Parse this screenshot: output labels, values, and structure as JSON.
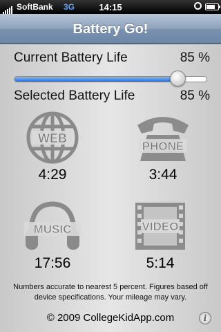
{
  "status_bar": {
    "carrier": "SoftBank",
    "network": "3G",
    "time": "14:15"
  },
  "nav": {
    "title": "Battery Go!"
  },
  "current": {
    "label": "Current Battery Life",
    "value": "85 %",
    "slider_fraction": 0.85
  },
  "selected": {
    "label": "Selected Battery Life",
    "value": "85 %"
  },
  "tiles": [
    {
      "name": "WEB",
      "time": "4:29",
      "icon": "globe-icon"
    },
    {
      "name": "PHONE",
      "time": "3:44",
      "icon": "phone-icon"
    },
    {
      "name": "MUSIC",
      "time": "17:56",
      "icon": "headphones-icon"
    },
    {
      "name": "VIDEO",
      "time": "5:14",
      "icon": "film-icon"
    }
  ],
  "footer": {
    "note": "Numbers accurate to nearest 5 percent. Figures based off device specifications. Your mileage may vary.",
    "copyright": "© 2009 CollegeKidApp.com"
  },
  "colors": {
    "nav_bar": "#7a92b0",
    "slider_fill": "#2b6ed8"
  }
}
